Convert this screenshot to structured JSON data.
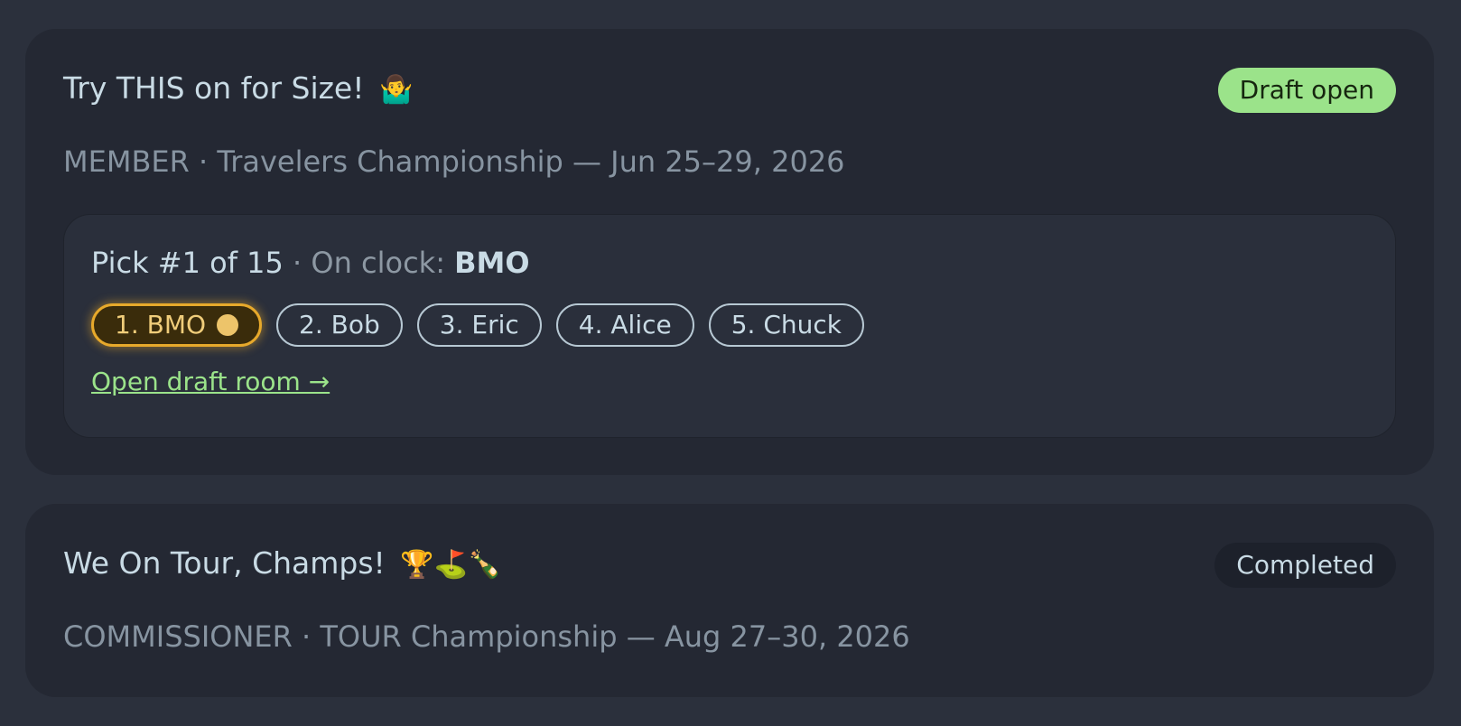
{
  "leagues": [
    {
      "title": "Try THIS on for Size!",
      "title_emoji": "🤷‍♂️",
      "status": "Draft open",
      "subtitle": "MEMBER · Travelers Championship — Jun 25–29, 2026",
      "draft": {
        "pick_label": "Pick #1 of 15",
        "separator": "·",
        "clock_label": "On clock:",
        "clock_name": "BMO",
        "order": [
          "1. BMO",
          "2. Bob",
          "3. Eric",
          "4. Alice",
          "5. Chuck"
        ],
        "active_index": 0,
        "link_label": "Open draft room →"
      },
      "colors": {
        "status_bg": "#9be38a",
        "active_chip": "#e7a92b"
      }
    },
    {
      "title": "We On Tour, Champs!",
      "title_emoji": "🏆⛳🍾",
      "status": "Completed",
      "subtitle": "COMMISSIONER · TOUR Championship — Aug 27–30, 2026",
      "colors": {
        "status_bg": "#1d212b"
      }
    }
  ]
}
